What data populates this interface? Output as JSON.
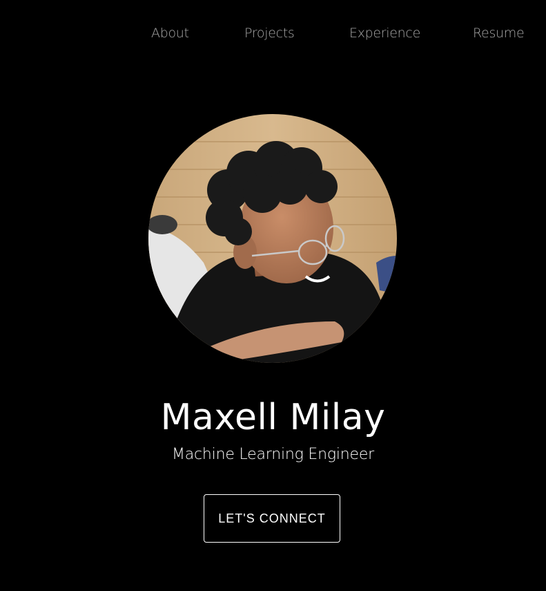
{
  "nav": {
    "items": [
      {
        "label": "About"
      },
      {
        "label": "Projects"
      },
      {
        "label": "Experience"
      },
      {
        "label": "Resume"
      }
    ]
  },
  "hero": {
    "name": "Maxell Milay",
    "title": "Machine Learning Engineer",
    "cta_label": "LET'S CONNECT",
    "photo_icon": "profile-photo"
  },
  "colors": {
    "background": "#000000",
    "nav_text": "#a8a8a8",
    "text": "#ffffff",
    "button_border": "#ffffff"
  }
}
